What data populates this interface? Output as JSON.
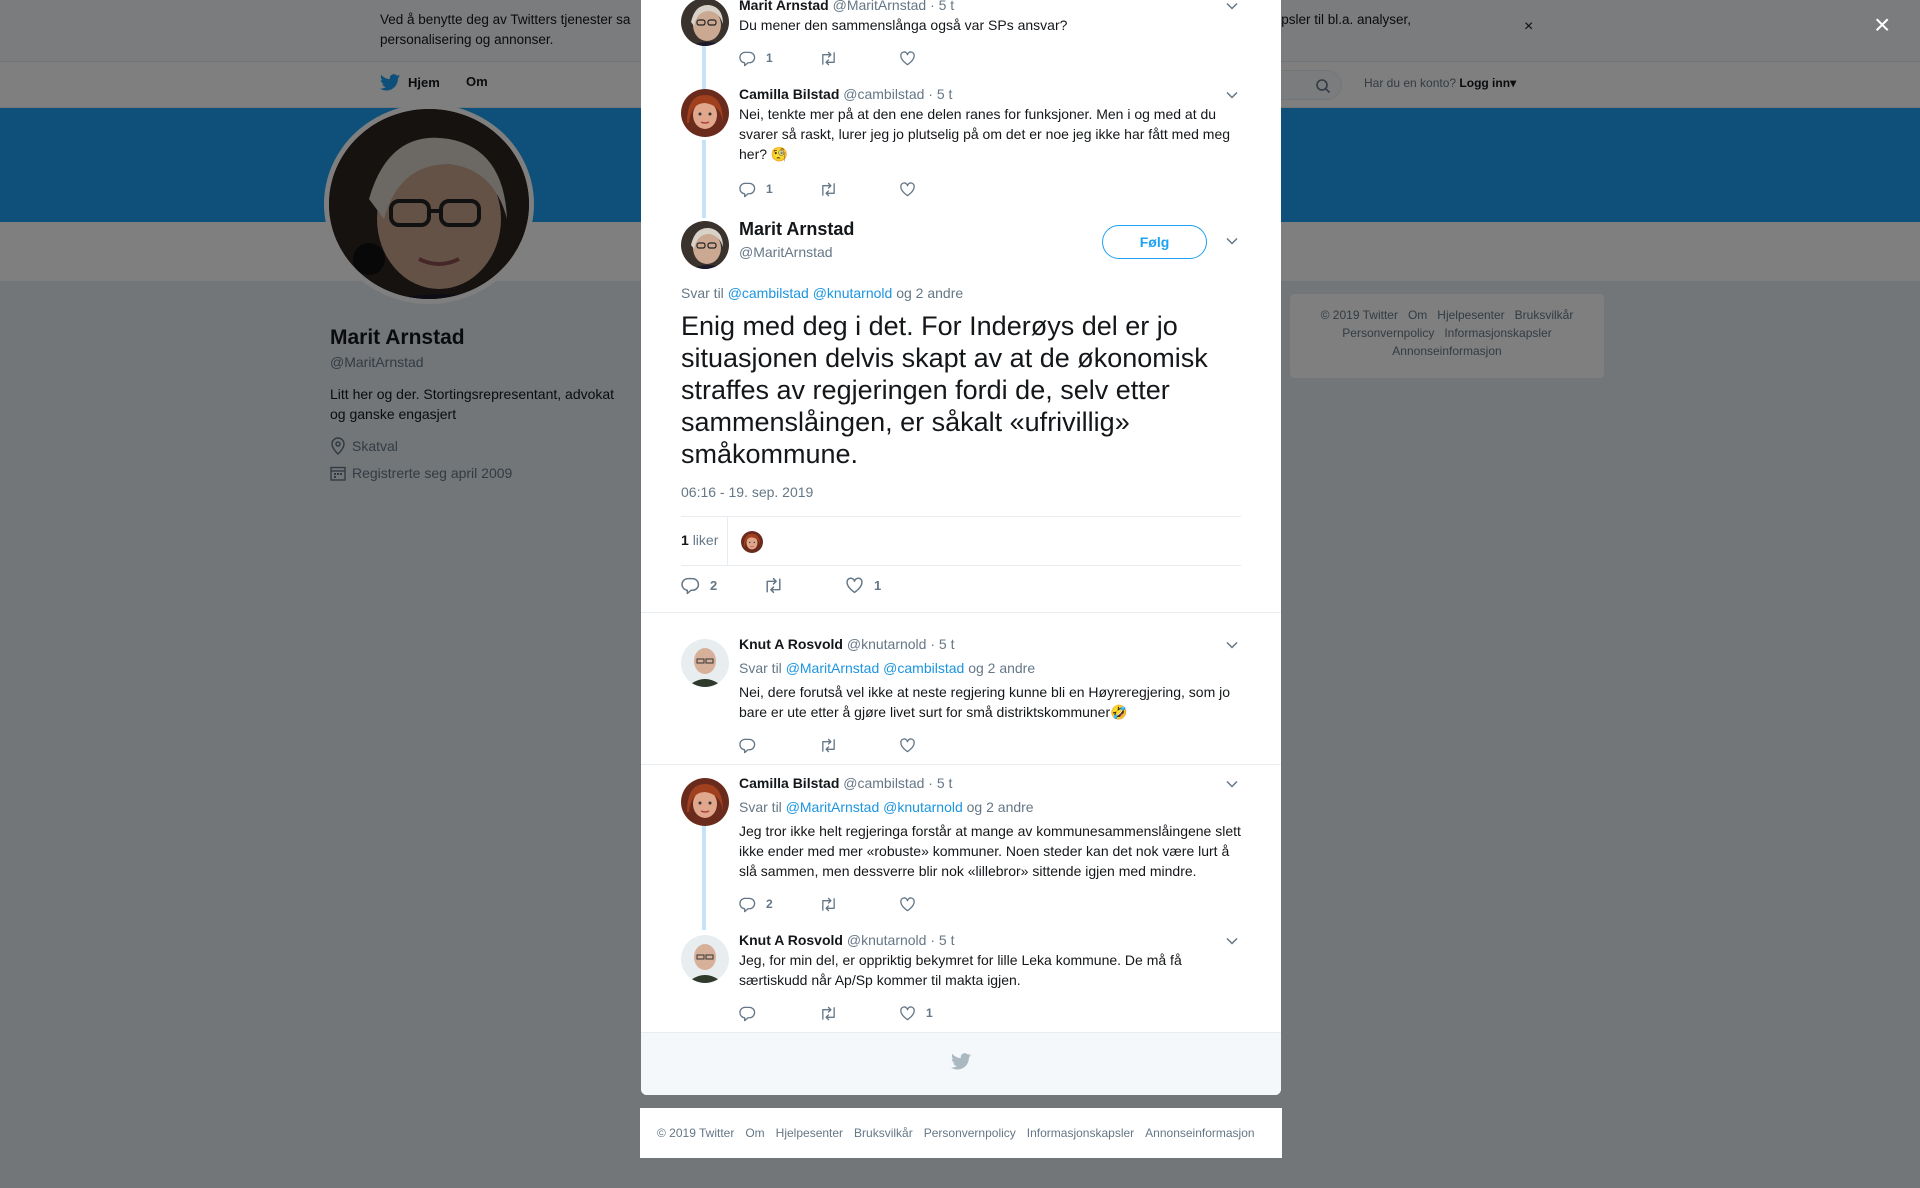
{
  "cookie_banner": {
    "text_line1": "Ved å benytte deg av Twitters tjenester sa",
    "text_right": "informasjonskapsler til bl.a. analyser,",
    "text_line2": "personalisering og annonser.",
    "close": "×"
  },
  "topnav": {
    "home": "Hjem",
    "about": "Om",
    "login_prompt": "Har du en konto?",
    "login": "Logg inn"
  },
  "profile": {
    "name": "Marit Arnstad",
    "handle": "@MaritArnstad",
    "bio": "Litt her og der. Stortingsrepresentant, advokat og ganske engasjert",
    "location": "Skatval",
    "joined": "Registrerte seg april 2009"
  },
  "side_footer": {
    "items": [
      "© 2019 Twitter",
      "Om",
      "Hjelpesenter",
      "Bruksvilkår",
      "Personvernpolicy",
      "Informasjonskapsler",
      "Annonseinformasjon"
    ]
  },
  "overlay": {
    "close": "×"
  },
  "thread_above": [
    {
      "name": "Marit Arnstad",
      "handle": "@MaritArnstad",
      "time": "· 5 t",
      "text": "Du mener den sammenslånga også var SPs ansvar?",
      "reply_count": "1",
      "like_count": ""
    },
    {
      "name": "Camilla Bilstad",
      "handle": "@cambilstad",
      "time": "· 5 t",
      "text": "Nei, tenkte mer på at den ene delen ranes for funksjoner. Men i og med at du svarer så raskt, lurer jeg jo plutselig på om det er noe jeg ikke har fått med meg her? 🧐",
      "reply_count": "1",
      "like_count": ""
    }
  ],
  "main_tweet": {
    "name": "Marit Arnstad",
    "handle": "@MaritArnstad",
    "follow": "Følg",
    "reply_prefix": "Svar til",
    "reply_to1": "@cambilstad",
    "reply_to2": "@knutarnold",
    "reply_more": "og 2 andre",
    "text": "Enig med deg i det. For Inderøys del er jo situasjonen delvis skapt av at de økonomisk straffes av regjeringen fordi de, selv etter sammenslåingen, er såkalt «ufrivillig» småkommune.",
    "timestamp": "06:16 - 19. sep. 2019",
    "likes_number": "1",
    "likes_label": "liker",
    "reply_count": "2",
    "retweet_count": "",
    "like_count": "1"
  },
  "replies": [
    {
      "name": "Knut A Rosvold",
      "handle": "@knutarnold",
      "time": "· 5 t",
      "reply_prefix": "Svar til",
      "reply_to1": "@MaritArnstad",
      "reply_to2": "@cambilstad",
      "reply_more": "og 2 andre",
      "text": "Nei, dere forutså vel ikke at neste regjering kunne bli en Høyreregjering, som jo bare er ute etter å gjøre livet surt for små distriktskommuner🤣",
      "reply_count": "",
      "like_count": ""
    },
    {
      "name": "Camilla Bilstad",
      "handle": "@cambilstad",
      "time": "· 5 t",
      "reply_prefix": "Svar til",
      "reply_to1": "@MaritArnstad",
      "reply_to2": "@knutarnold",
      "reply_more": "og 2 andre",
      "text": "Jeg tror ikke helt regjeringa forstår at mange av kommunesammenslåingene slett ikke ender med mer «robuste» kommuner. Noen steder kan det nok være lurt å slå sammen, men dessverre blir nok «lillebror» sittende igjen med mindre.",
      "reply_count": "2",
      "like_count": ""
    },
    {
      "name": "Knut A Rosvold",
      "handle": "@knutarnold",
      "time": "· 5 t",
      "text": "Jeg, for min del, er oppriktig bekymret for lille Leka kommune. De må få særtiskudd når Ap/Sp kommer til makta igjen.",
      "reply_count": "",
      "like_count": "1"
    }
  ],
  "modal_footer": {
    "items": [
      "© 2019 Twitter",
      "Om",
      "Hjelpesenter",
      "Bruksvilkår",
      "Personvernpolicy",
      "Informasjonskapsler",
      "Annonseinformasjon"
    ]
  },
  "colors": {
    "accent": "#1da1f2",
    "link": "#1b95e0",
    "muted": "#657786",
    "like": "#e0245e"
  }
}
